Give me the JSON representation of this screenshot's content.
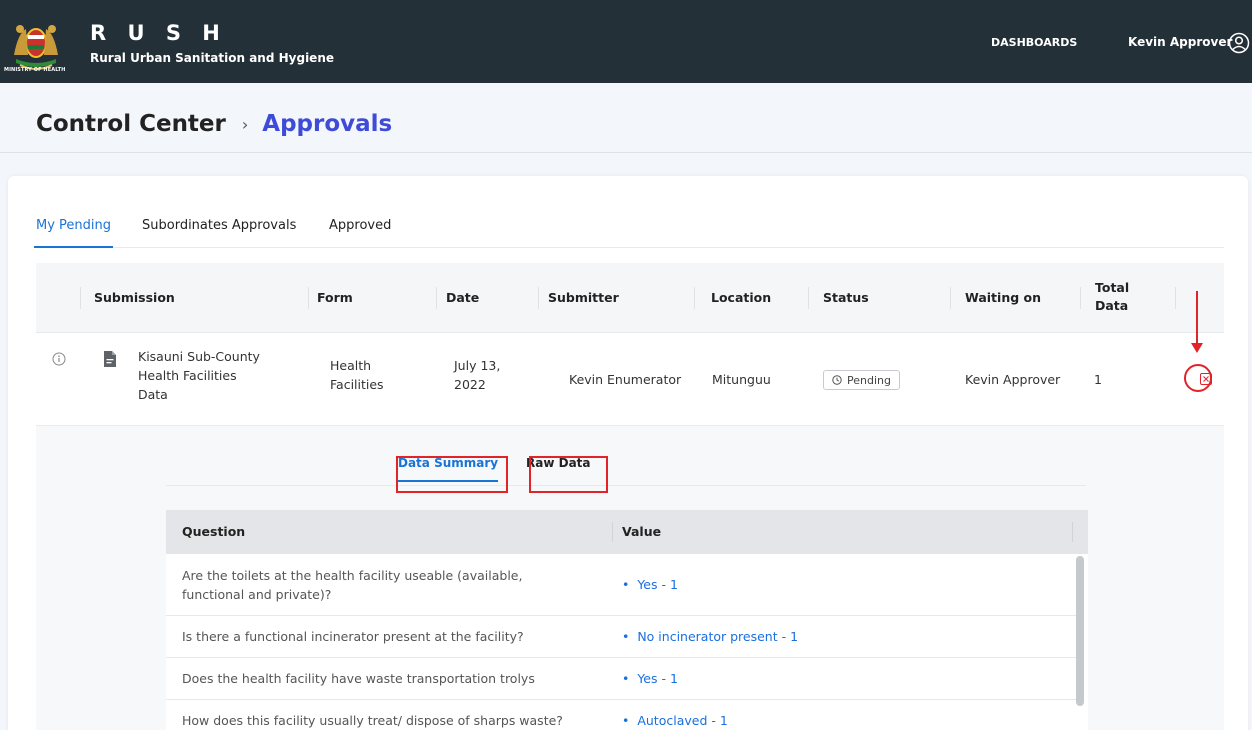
{
  "header": {
    "logo_caption": "MINISTRY OF HEALTH",
    "title": "R U S H",
    "subtitle": "Rural Urban Sanitation and Hygiene",
    "nav_dashboards": "DASHBOARDS",
    "user_name": "Kevin Approver"
  },
  "breadcrumb": {
    "root": "Control Center",
    "separator": "›",
    "current": "Approvals"
  },
  "tabs": [
    "My Pending",
    "Subordinates Approvals",
    "Approved"
  ],
  "table": {
    "headers": {
      "submission": "Submission",
      "form": "Form",
      "date": "Date",
      "submitter": "Submitter",
      "location": "Location",
      "status": "Status",
      "waiting_on": "Waiting on",
      "total_data": "Total Data"
    },
    "row": {
      "submission": "Kisauni Sub-County Health Facilities Data",
      "form": "Health Facilities",
      "date": "July 13, 2022",
      "submitter": "Kevin Enumerator",
      "location": "Mitunguu",
      "status": "Pending",
      "waiting_on": "Kevin Approver",
      "total_data": "1"
    }
  },
  "subtabs": [
    "Data Summary",
    "Raw Data"
  ],
  "summary": {
    "headers": {
      "question": "Question",
      "value": "Value"
    },
    "rows": [
      {
        "question": "Are the toilets at the health facility useable (available, functional and private)?",
        "value": "Yes - 1"
      },
      {
        "question": "Is there a functional incinerator present at the facility?",
        "value": "No incinerator present - 1"
      },
      {
        "question": "Does the health facility have waste transportation trolys",
        "value": "Yes - 1"
      },
      {
        "question": "How does this facility usually treat/ dispose of sharps waste?",
        "value": "Autoclaved - 1"
      }
    ]
  },
  "colors": {
    "header_bg": "#243038",
    "accent_blue": "#1a73d6",
    "breadcrumb_blue": "#3d4bd8",
    "annotation_red": "#e0242a"
  }
}
